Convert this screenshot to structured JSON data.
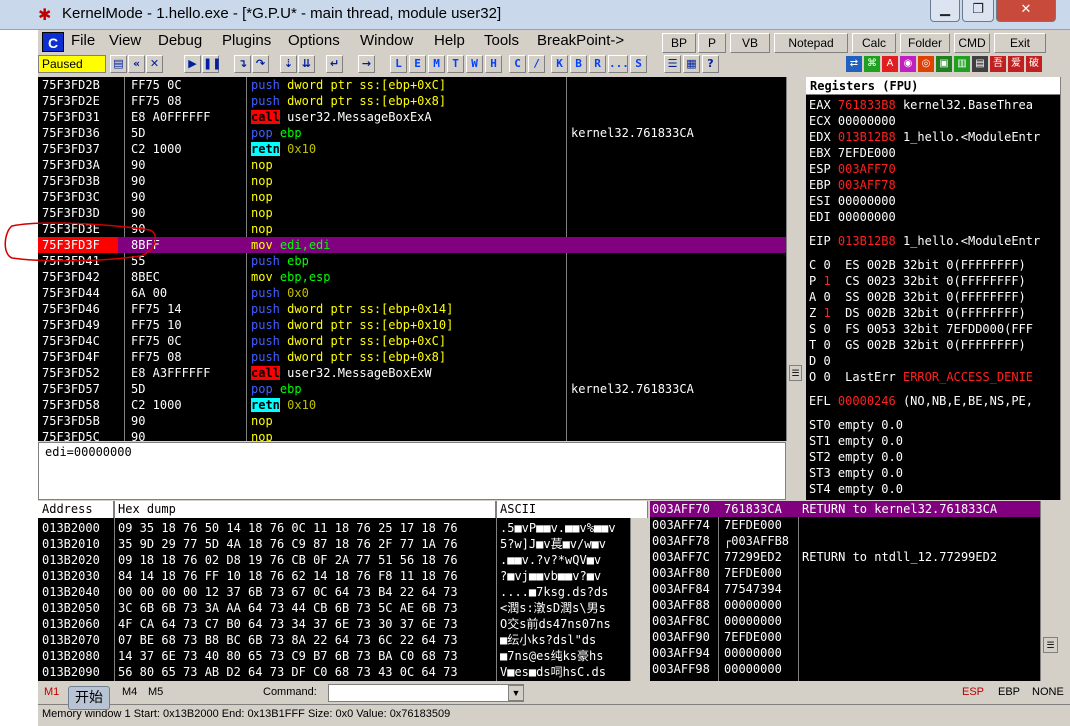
{
  "window": {
    "title": "KernelMode - 1.hello.exe - [*G.P.U* - main thread, module user32]",
    "minimize_icon": "minimize-icon",
    "maximize_icon": "maximize-icon",
    "close_icon": "close-icon"
  },
  "menu": {
    "items": [
      "File",
      "View",
      "Debug",
      "Plugins",
      "Options",
      "Window",
      "Help",
      "Tools",
      "BreakPoint->"
    ],
    "right_buttons": [
      "BP",
      "P",
      "VB",
      "Notepad",
      "Calc",
      "Folder",
      "CMD",
      "Exit"
    ],
    "c_label": "C"
  },
  "toolbar": {
    "status": "Paused",
    "letters": [
      "L",
      "E",
      "M",
      "T",
      "W",
      "H",
      "C",
      "/",
      "K",
      "B",
      "R",
      "...",
      "S"
    ]
  },
  "cpu": {
    "selected_row": 10,
    "rows": [
      {
        "addr": "75F3FD2B",
        "hex": "FF75 0C",
        "mn": "push",
        "args": "dword ptr ss:[ebp+0xC]",
        "comment": ""
      },
      {
        "addr": "75F3FD2E",
        "hex": "FF75 08",
        "mn": "push",
        "args": "dword ptr ss:[ebp+0x8]",
        "comment": ""
      },
      {
        "addr": "75F3FD31",
        "hex": "E8 A0FFFFFF",
        "mn": "call",
        "args": "user32.MessageBoxExA",
        "comment": ""
      },
      {
        "addr": "75F3FD36",
        "hex": "5D",
        "mn": "pop",
        "args": "ebp",
        "comment": "kernel32.761833CA"
      },
      {
        "addr": "75F3FD37",
        "hex": "C2 1000",
        "mn": "retn",
        "args": "0x10",
        "comment": ""
      },
      {
        "addr": "75F3FD3A",
        "hex": "90",
        "mn": "nop",
        "args": "",
        "comment": ""
      },
      {
        "addr": "75F3FD3B",
        "hex": "90",
        "mn": "nop",
        "args": "",
        "comment": ""
      },
      {
        "addr": "75F3FD3C",
        "hex": "90",
        "mn": "nop",
        "args": "",
        "comment": ""
      },
      {
        "addr": "75F3FD3D",
        "hex": "90",
        "mn": "nop",
        "args": "",
        "comment": ""
      },
      {
        "addr": "75F3FD3E",
        "hex": "90",
        "mn": "nop",
        "args": "",
        "comment": ""
      },
      {
        "addr": "75F3FD3F",
        "hex": "8BFF",
        "mn": "mov",
        "args": "edi,edi",
        "comment": ""
      },
      {
        "addr": "75F3FD41",
        "hex": "55",
        "mn": "push",
        "args": "ebp",
        "comment": ""
      },
      {
        "addr": "75F3FD42",
        "hex": "8BEC",
        "mn": "mov",
        "args": "ebp,esp",
        "comment": ""
      },
      {
        "addr": "75F3FD44",
        "hex": "6A 00",
        "mn": "push",
        "args": "0x0",
        "comment": ""
      },
      {
        "addr": "75F3FD46",
        "hex": "FF75 14",
        "mn": "push",
        "args": "dword ptr ss:[ebp+0x14]",
        "comment": ""
      },
      {
        "addr": "75F3FD49",
        "hex": "FF75 10",
        "mn": "push",
        "args": "dword ptr ss:[ebp+0x10]",
        "comment": ""
      },
      {
        "addr": "75F3FD4C",
        "hex": "FF75 0C",
        "mn": "push",
        "args": "dword ptr ss:[ebp+0xC]",
        "comment": ""
      },
      {
        "addr": "75F3FD4F",
        "hex": "FF75 08",
        "mn": "push",
        "args": "dword ptr ss:[ebp+0x8]",
        "comment": ""
      },
      {
        "addr": "75F3FD52",
        "hex": "E8 A3FFFFFF",
        "mn": "call",
        "args": "user32.MessageBoxExW",
        "comment": ""
      },
      {
        "addr": "75F3FD57",
        "hex": "5D",
        "mn": "pop",
        "args": "ebp",
        "comment": "kernel32.761833CA"
      },
      {
        "addr": "75F3FD58",
        "hex": "C2 1000",
        "mn": "retn",
        "args": "0x10",
        "comment": ""
      },
      {
        "addr": "75F3FD5B",
        "hex": "90",
        "mn": "nop",
        "args": "",
        "comment": ""
      },
      {
        "addr": "75F3FD5C",
        "hex": "90",
        "mn": "nop",
        "args": "",
        "comment": ""
      }
    ]
  },
  "info_line": "edi=00000000",
  "registers": {
    "header": "Registers (FPU)",
    "lines": [
      {
        "name": "EAX",
        "val": "761833B8",
        "red": true,
        "desc": "kernel32.BaseThrea"
      },
      {
        "name": "ECX",
        "val": "00000000",
        "red": false,
        "desc": ""
      },
      {
        "name": "EDX",
        "val": "013B12B8",
        "red": true,
        "desc": "1_hello.<ModuleEntr"
      },
      {
        "name": "EBX",
        "val": "7EFDE000",
        "red": false,
        "desc": ""
      },
      {
        "name": "ESP",
        "val": "003AFF70",
        "red": true,
        "desc": ""
      },
      {
        "name": "EBP",
        "val": "003AFF78",
        "red": true,
        "desc": ""
      },
      {
        "name": "ESI",
        "val": "00000000",
        "red": false,
        "desc": ""
      },
      {
        "name": "EDI",
        "val": "00000000",
        "red": false,
        "desc": ""
      },
      {
        "name": "EIP",
        "val": "013B12B8",
        "red": true,
        "desc": "1_hello.<ModuleEntr"
      }
    ],
    "flags": [
      {
        "f": "C",
        "v": "0",
        "seg": "ES 002B 32bit 0(FFFFFFFF)",
        "red": false
      },
      {
        "f": "P",
        "v": "1",
        "seg": "CS 0023 32bit 0(FFFFFFFF)",
        "red": true
      },
      {
        "f": "A",
        "v": "0",
        "seg": "SS 002B 32bit 0(FFFFFFFF)",
        "red": false
      },
      {
        "f": "Z",
        "v": "1",
        "seg": "DS 002B 32bit 0(FFFFFFFF)",
        "red": true
      },
      {
        "f": "S",
        "v": "0",
        "seg": "FS 0053 32bit 7EFDD000(FFF",
        "red": false
      },
      {
        "f": "T",
        "v": "0",
        "seg": "GS 002B 32bit 0(FFFFFFFF)",
        "red": false
      },
      {
        "f": "D",
        "v": "0",
        "seg": "",
        "red": false
      },
      {
        "f": "O",
        "v": "0",
        "seg": "LastErr",
        "red": false
      }
    ],
    "lasterr": "ERROR_ACCESS_DENIE",
    "efl_label": "EFL",
    "efl_val": "00000246",
    "efl_desc": "(NO,NB,E,BE,NS,PE,",
    "fpu": [
      "ST0 empty 0.0",
      "ST1 empty 0.0",
      "ST2 empty 0.0",
      "ST3 empty 0.0",
      "ST4 empty 0.0"
    ]
  },
  "dump": {
    "headers": {
      "address": "Address",
      "hex": "Hex dump",
      "ascii": "ASCII"
    },
    "rows": [
      {
        "addr": "013B2000",
        "hex": "09 35 18 76 50 14 18 76 0C 11 18 76 25 17 18 76",
        "ascii": ".5■vP■■v.■■v%■■v"
      },
      {
        "addr": "013B2010",
        "hex": "35 9D 29 77 5D 4A 18 76 C9 87 18 76 2F 77 1A 76",
        "ascii": "5?w]J■v萇■v/w■v"
      },
      {
        "addr": "013B2020",
        "hex": "09 18 18 76 02 D8 19 76 CB 0F 2A 77 51 56 18 76",
        "ascii": ".■■v.?v?*wQV■v"
      },
      {
        "addr": "013B2030",
        "hex": "84 14 18 76 FF 10 18 76 62 14 18 76 F8 11 18 76",
        "ascii": "?■vj■■vb■■v?■v"
      },
      {
        "addr": "013B2040",
        "hex": "00 00 00 00 12 37 6B 73 67 0C 64 73 B4 22 64 73",
        "ascii": "....■7ksg.ds?ds"
      },
      {
        "addr": "013B2050",
        "hex": "3C 6B 6B 73 3A AA 64 73 44 CB 6B 73 5C AE 6B 73",
        "ascii": "<潤s:潡sD潤s\\男s"
      },
      {
        "addr": "013B2060",
        "hex": "4F CA 64 73 C7 B0 64 73 34 37 6E 73 30 37 6E 73",
        "ascii": "O交s前ds47ns07ns"
      },
      {
        "addr": "013B2070",
        "hex": "07 BE 68 73 B8 BC 6B 73 8A 22 64 73 6C 22 64 73",
        "ascii": "■纭小ks?dsl\"ds"
      },
      {
        "addr": "013B2080",
        "hex": "14 37 6E 73 40 80 65 73 C9 B7 6B 73 BA C0 68 73",
        "ascii": "■7ns@es纯ks豪hs"
      },
      {
        "addr": "013B2090",
        "hex": "56 80 65 73 AB D2 64 73 DF C0 68 73 43 0C 64 73",
        "ascii": "V■es■ds呞hsC.ds"
      }
    ]
  },
  "stack": {
    "rows": [
      {
        "addr": "003AFF70",
        "val": "761833CA",
        "comment": "RETURN to kernel32.761833CA"
      },
      {
        "addr": "003AFF74",
        "val": "7EFDE000",
        "comment": ""
      },
      {
        "addr": "003AFF78",
        "val": "┌003AFFB8",
        "comment": ""
      },
      {
        "addr": "003AFF7C",
        "val": "77299ED2",
        "comment": "RETURN to ntdll_12.77299ED2"
      },
      {
        "addr": "003AFF80",
        "val": "7EFDE000",
        "comment": ""
      },
      {
        "addr": "003AFF84",
        "val": "77547394",
        "comment": ""
      },
      {
        "addr": "003AFF88",
        "val": "00000000",
        "comment": ""
      },
      {
        "addr": "003AFF8C",
        "val": "00000000",
        "comment": ""
      },
      {
        "addr": "003AFF90",
        "val": "7EFDE000",
        "comment": ""
      },
      {
        "addr": "003AFF94",
        "val": "00000000",
        "comment": ""
      },
      {
        "addr": "003AFF98",
        "val": "00000000",
        "comment": ""
      }
    ]
  },
  "statusbar": {
    "m1": "M1",
    "m4": "M4",
    "m5": "M5",
    "command_label": "Command:",
    "esp": "ESP",
    "ebp": "EBP",
    "none": "NONE",
    "memory_info": "Memory window 1  Start: 0x13B2000  End: 0x13B1FFF  Size: 0x0 Value: 0x76183509",
    "start_tooltip": "开始"
  }
}
